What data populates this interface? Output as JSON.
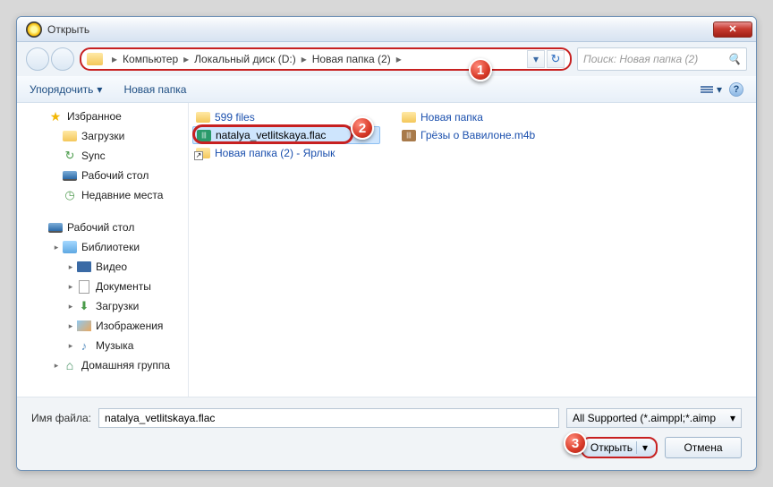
{
  "window": {
    "title": "Открыть",
    "close_glyph": "✕"
  },
  "breadcrumb": {
    "items": [
      "Компьютер",
      "Локальный диск (D:)",
      "Новая папка (2)"
    ],
    "sep": "▸",
    "refresh_glyph": "↻"
  },
  "search": {
    "placeholder": "Поиск: Новая папка (2)"
  },
  "toolbar": {
    "organize": "Упорядочить",
    "newfolder": "Новая папка",
    "dropdown_glyph": "▾",
    "help_glyph": "?"
  },
  "sidebar": {
    "items": [
      {
        "indent": 1,
        "exp": "",
        "icon": "star",
        "label": "Избранное"
      },
      {
        "indent": 2,
        "exp": "",
        "icon": "folder",
        "label": "Загрузки"
      },
      {
        "indent": 2,
        "exp": "",
        "icon": "sync",
        "label": "Sync"
      },
      {
        "indent": 2,
        "exp": "",
        "icon": "desktop",
        "label": "Рабочий стол"
      },
      {
        "indent": 2,
        "exp": "",
        "icon": "recent",
        "label": "Недавние места"
      },
      {
        "indent": 0,
        "exp": "",
        "icon": "",
        "label": ""
      },
      {
        "indent": 1,
        "exp": "",
        "icon": "desktop",
        "label": "Рабочий стол"
      },
      {
        "indent": 2,
        "exp": "▸",
        "icon": "lib",
        "label": "Библиотеки"
      },
      {
        "indent": 3,
        "exp": "▸",
        "icon": "video",
        "label": "Видео"
      },
      {
        "indent": 3,
        "exp": "▸",
        "icon": "doc",
        "label": "Документы"
      },
      {
        "indent": 3,
        "exp": "▸",
        "icon": "dl",
        "label": "Загрузки"
      },
      {
        "indent": 3,
        "exp": "▸",
        "icon": "img",
        "label": "Изображения"
      },
      {
        "indent": 3,
        "exp": "▸",
        "icon": "music",
        "label": "Музыка"
      },
      {
        "indent": 2,
        "exp": "▸",
        "icon": "home",
        "label": "Домашняя группа"
      }
    ]
  },
  "files": {
    "col1": [
      {
        "icon": "folder",
        "label": "599 files",
        "selected": false
      },
      {
        "icon": "audio-g",
        "label": "natalya_vetlitskaya.flac",
        "selected": true
      },
      {
        "icon": "link",
        "label": "Новая папка (2) - Ярлык",
        "selected": false
      }
    ],
    "col2": [
      {
        "icon": "folder",
        "label": "Новая папка",
        "selected": false
      },
      {
        "icon": "audio-b",
        "label": "Грёзы о Вавилоне.m4b",
        "selected": false
      }
    ]
  },
  "footer": {
    "filename_label": "Имя файла:",
    "filename_value": "natalya_vetlitskaya.flac",
    "filter": "All Supported (*.aimppl;*.aimp",
    "open": "Открыть",
    "cancel": "Отмена",
    "split_glyph": "▾"
  },
  "markers": {
    "m1": "1",
    "m2": "2",
    "m3": "3"
  }
}
